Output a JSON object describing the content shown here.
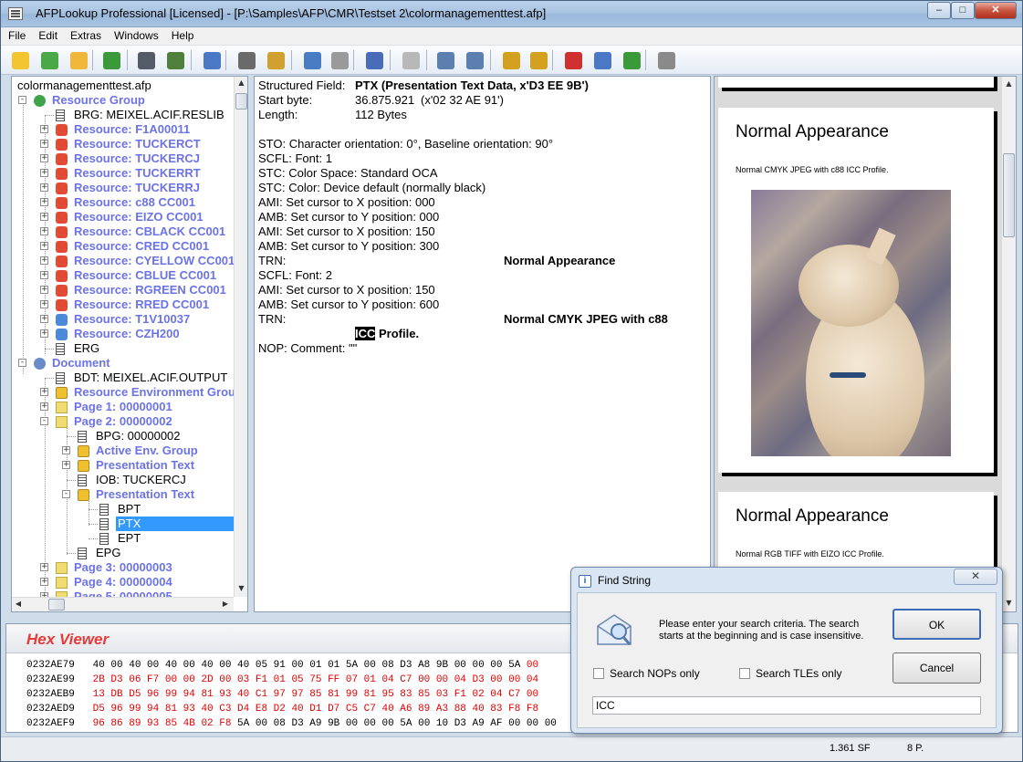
{
  "window": {
    "title": "AFPLookup Professional   [Licensed] - [P:\\Samples\\AFP\\CMR\\Testset 2\\colormanagementtest.afp]",
    "min_label": "–",
    "max_label": "□",
    "close_label": "✕"
  },
  "menu": [
    "File",
    "Edit",
    "Extras",
    "Windows",
    "Help"
  ],
  "toolbar": {
    "buttons": [
      {
        "name": "open-folder-icon",
        "color": "#f2c531"
      },
      {
        "name": "export-icon",
        "color": "#4aa847"
      },
      {
        "name": "folder-icon",
        "color": "#f0b73a"
      },
      {
        "name": "refresh-icon",
        "color": "#3a9a3a"
      },
      {
        "name": "binoculars-icon",
        "color": "#555b66"
      },
      {
        "name": "find-next-icon",
        "color": "#4f7f3a"
      },
      {
        "name": "checklist-icon",
        "color": "#4a78c4"
      },
      {
        "name": "stamp-icon",
        "color": "#6a6a6a"
      },
      {
        "name": "tools-icon",
        "color": "#d0a030"
      },
      {
        "name": "zoom-page-icon",
        "color": "#4a7cc4"
      },
      {
        "name": "image-icon",
        "color": "#9a9a9a"
      },
      {
        "name": "help-icon",
        "color": "#4a6cb8"
      },
      {
        "name": "stop-icon",
        "color": "#b8b8b8"
      },
      {
        "name": "ruler-icon",
        "color": "#5a7fb0"
      },
      {
        "name": "grid-icon",
        "color": "#5a7fb0"
      },
      {
        "name": "fit-width-icon",
        "color": "#d4a020"
      },
      {
        "name": "fit-page-icon",
        "color": "#d4a020"
      },
      {
        "name": "zoom-out-icon",
        "color": "#d03030"
      },
      {
        "name": "zoom-actual-icon",
        "color": "#4a78c4"
      },
      {
        "name": "zoom-in-icon",
        "color": "#3a9a3a"
      },
      {
        "name": "print-icon",
        "color": "#8a8a8a"
      }
    ]
  },
  "tree": {
    "root": "colormanagementtest.afp",
    "rows": [
      {
        "label": "Resource Group",
        "blue": true
      },
      {
        "label": "BRG: MEIXEL.ACIF.RESLIB",
        "blue": false
      },
      {
        "label": "Resource: F1A00011",
        "blue": true
      },
      {
        "label": "Resource: TUCKERCT",
        "blue": true
      },
      {
        "label": "Resource: TUCKERCJ",
        "blue": true
      },
      {
        "label": "Resource: TUCKERRT",
        "blue": true
      },
      {
        "label": "Resource: TUCKERRJ",
        "blue": true
      },
      {
        "label": "Resource: c88      CC001",
        "blue": true
      },
      {
        "label": "Resource: EIZO     CC001",
        "blue": true
      },
      {
        "label": "Resource: CBLACK  CC001",
        "blue": true
      },
      {
        "label": "Resource: CRED     CC001",
        "blue": true
      },
      {
        "label": "Resource: CYELLOW CC001",
        "blue": true
      },
      {
        "label": "Resource: CBLUE    CC001",
        "blue": true
      },
      {
        "label": "Resource: RGREEN  CC001",
        "blue": true
      },
      {
        "label": "Resource: RRED     CC001",
        "blue": true
      },
      {
        "label": "Resource: T1V10037",
        "blue": true
      },
      {
        "label": "Resource: CZH200",
        "blue": true
      },
      {
        "label": "ERG",
        "blue": false
      },
      {
        "label": "Document",
        "blue": true
      },
      {
        "label": "BDT: MEIXEL.ACIF.OUTPUT",
        "blue": false
      },
      {
        "label": "Resource Environment Group",
        "blue": true
      },
      {
        "label": "Page 1: 00000001",
        "blue": true
      },
      {
        "label": "Page 2: 00000002",
        "blue": true
      },
      {
        "label": "BPG: 00000002",
        "blue": false
      },
      {
        "label": "Active Env. Group",
        "blue": true
      },
      {
        "label": "Presentation Text",
        "blue": true
      },
      {
        "label": "IOB: TUCKERCJ",
        "blue": false
      },
      {
        "label": "Presentation Text",
        "blue": true
      },
      {
        "label": "BPT",
        "blue": false
      },
      {
        "label": "PTX",
        "blue": false
      },
      {
        "label": "EPT",
        "blue": false
      },
      {
        "label": "EPG",
        "blue": false
      },
      {
        "label": "Page 3: 00000003",
        "blue": true
      },
      {
        "label": "Page 4: 00000004",
        "blue": true
      },
      {
        "label": "Page 5: 00000005",
        "blue": true
      }
    ]
  },
  "details": {
    "field_label": "Structured Field:",
    "field_value": "PTX (Presentation Text Data, x'D3 EE 9B')",
    "start_label": "Start byte:",
    "start_value": "36.875.921",
    "start_hex": "(x'02 32 AE 91')",
    "length_label": "Length:",
    "length_value": "112 Bytes",
    "lines": [
      "STO: Character orientation: 0°, Baseline orientation: 90°",
      "SCFL: Font: 1",
      "STC: Color Space: Standard OCA",
      "STC: Color: Device default (normally black)",
      "AMI: Set cursor to X position: 000",
      "AMB: Set cursor to Y position: 000",
      "AMI: Set cursor to X position: 150",
      "AMB: Set cursor to Y position: 300"
    ],
    "trn1_label": "TRN:",
    "trn1_text": "Normal Appearance",
    "lines2": [
      "SCFL: Font: 2",
      "AMI: Set cursor to X position: 150",
      "AMB: Set cursor to Y position: 600"
    ],
    "trn2_label": "TRN:",
    "trn2_text": "Normal CMYK JPEG with c88",
    "trn2_highlight": "ICC",
    "trn2_rest": " Profile.",
    "nop": "NOP: Comment: \"\""
  },
  "preview": {
    "page1_title": "Normal Appearance",
    "page1_caption": "Normal CMYK JPEG with c88 ICC Profile.",
    "page2_title": "Normal Appearance",
    "page2_caption": "Normal RGB TIFF with EIZO ICC Profile."
  },
  "hex": {
    "title": "Hex Viewer",
    "rows": [
      {
        "offset": "0232AE79",
        "black": "40 00 40 00 40 00 40 00 40 05 91 00 01 01 5A 00 08 D3 A8 9B 00 00 00 5A",
        "red": " 00"
      },
      {
        "offset": "0232AE99",
        "black": "",
        "red": "2B D3 06 F7 00 00 2D 00 03 F1 01 05 75 FF 07 01 04 C7 00 00 04 D3 00 00 04"
      },
      {
        "offset": "0232AEB9",
        "black": "",
        "red": "13 DB D5 96 99 94 81 93 40 C1 97 97 85 81 99 81 95 83 85 03 F1 02 04 C7 00"
      },
      {
        "offset": "0232AED9",
        "black": "",
        "red": "D5 96 99 94 81 93 40 C3 D4 E8 D2 40 D1 D7 C5 C7 40 A6 89 A3 88 40 83 F8 F8"
      },
      {
        "offset": "0232AEF9",
        "black": "",
        "red": "96 86 89 93 85 4B 02 F8",
        "tail": " 5A 00 08 D3 A9 9B 00 00 00 5A 00 10 D3 A9 AF 00 00 00"
      }
    ]
  },
  "status": {
    "size": "1.361 SF",
    "pages": "8 P."
  },
  "find_dialog": {
    "title": "Find String",
    "message": "Please enter your search criteria. The search starts at the beginning and is case insensitive.",
    "ok_label": "OK",
    "cancel_label": "Cancel",
    "chk_nops_label": "Search NOPs only",
    "chk_tles_label": "Search TLEs only",
    "search_value": "ICC",
    "close_label": "✕"
  }
}
